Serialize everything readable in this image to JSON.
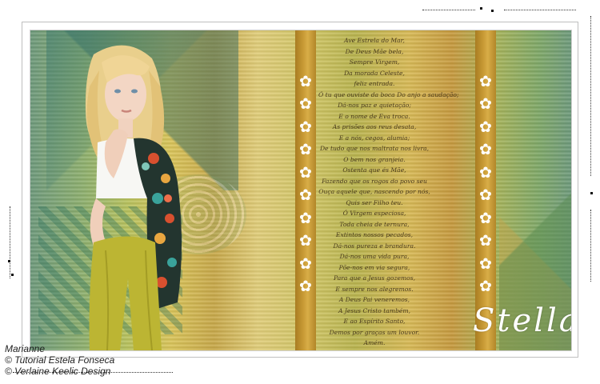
{
  "title": "Stella",
  "poem": [
    "Ave Estrela do Mar,",
    "De Deus Mãe bela,",
    "Sempre Virgem,",
    "Da morada Celeste,",
    "feliz entrada.",
    "Ó tu que ouviste da boca Do anjo a saudação;",
    "Dá-nos paz e quietação;",
    "E o nome de Eva troca.",
    "As prisões aos reus desata,",
    "E a nós, cegos, alumia;",
    "De tudo que nos maltrata nos livra,",
    "O bem nos granjeia.",
    "Ostenta que és Mãe,",
    "Fazendo que os rogos do povo seu",
    "Ouça aquele que, nascendo por nós,",
    "Quis ser Filho teu.",
    "Ó Virgem especiosa,",
    "Toda cheia de ternura,",
    "Extintos nossos pecados,",
    "Dá-nos pureza e brandura.",
    "Dá-nos uma vida pura,",
    "Põe-nos em via segura,",
    "Para que a Jesus gozemos,",
    "E sempre nos alegremos.",
    "A Deus Pai veneremos,",
    "A Jesus Cristo também,",
    "E ao Espírito Santo,",
    "Demos por graças um louvor.",
    "Amém."
  ],
  "credits": {
    "line1": "Marianne",
    "line2": "© Tutorial Estela Fonseca",
    "line3": "© Verlaine Keelic Design"
  },
  "colors": {
    "panel": "#c99b36",
    "title": "#ffffff",
    "frame": "#bfbfbf"
  }
}
